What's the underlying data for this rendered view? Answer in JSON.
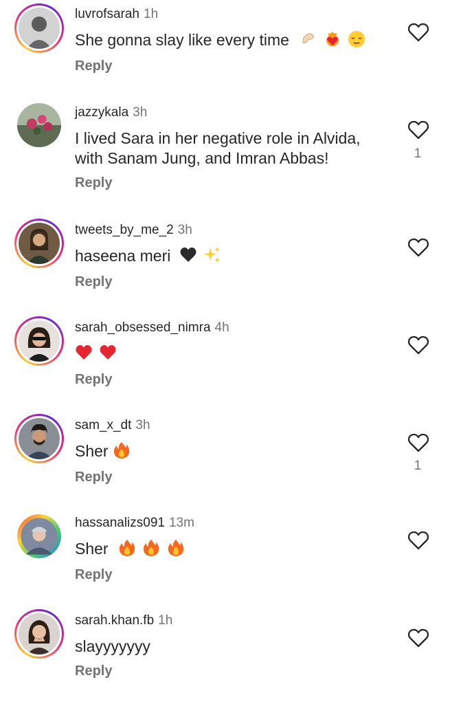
{
  "comments": [
    {
      "username": "luvrofsarah",
      "time": "1h",
      "text": "She gonna slay like every time",
      "emojis": [
        "pinching-hand-emoji",
        "heart-on-fire-emoji",
        "relieved-face-emoji"
      ],
      "reply_label": "Reply",
      "likes": "",
      "story_ring": true
    },
    {
      "username": "jazzykala",
      "time": "3h",
      "text": "I lived Sara in her negative role in Alvida, with Sanam Jung, and Imran Abbas!",
      "emojis": [],
      "reply_label": "Reply",
      "likes": "1",
      "story_ring": false
    },
    {
      "username": "tweets_by_me_2",
      "time": "3h",
      "text": "haseena meri",
      "emojis": [
        "black-heart-emoji",
        "sparkles-emoji"
      ],
      "reply_label": "Reply",
      "likes": "",
      "story_ring": true
    },
    {
      "username": "sarah_obsessed_nimra",
      "time": "4h",
      "text": "",
      "emojis": [
        "red-heart-emoji",
        "red-heart-emoji"
      ],
      "reply_label": "Reply",
      "likes": "",
      "story_ring": true
    },
    {
      "username": "sam_x_dt",
      "time": "3h",
      "text": "Sher",
      "emojis": [
        "fire-emoji"
      ],
      "reply_label": "Reply",
      "likes": "1",
      "story_ring": true
    },
    {
      "username": "hassanalizs091",
      "time": "13m",
      "text": "Sher",
      "emojis": [
        "fire-emoji",
        "fire-emoji",
        "fire-emoji"
      ],
      "reply_label": "Reply",
      "likes": "",
      "story_ring": false
    },
    {
      "username": "sarah.khan.fb",
      "time": "1h",
      "text": "slayyyyyyy",
      "emojis": [],
      "reply_label": "Reply",
      "likes": "",
      "story_ring": true
    }
  ],
  "icons": {
    "like": "heart-outline-icon"
  },
  "colors": {
    "text": "#262626",
    "secondary": "#737373",
    "ring_start": "#f9ce34",
    "ring_mid": "#ee2a7b",
    "ring_end": "#6228d7"
  }
}
